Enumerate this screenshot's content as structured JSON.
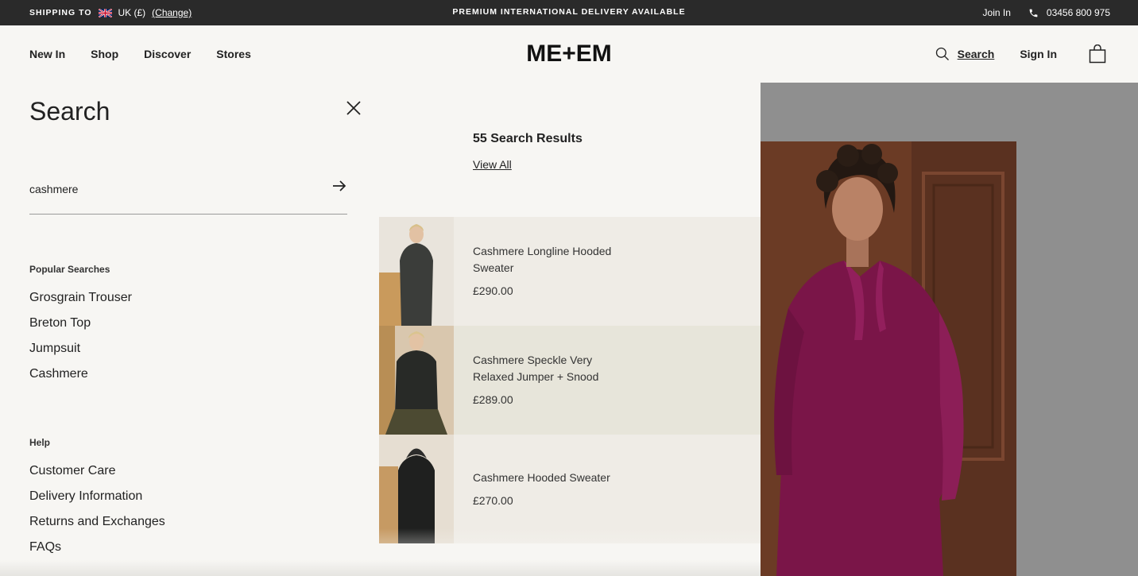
{
  "topbar": {
    "shipping_label": "SHIPPING TO",
    "region": "UK (£)",
    "change": "(Change)",
    "promo": "PREMIUM INTERNATIONAL DELIVERY AVAILABLE",
    "join": "Join In",
    "phone": "03456 800 975"
  },
  "header": {
    "nav": [
      "New In",
      "Shop",
      "Discover",
      "Stores"
    ],
    "logo": "ME+EM",
    "search": "Search",
    "signin": "Sign In",
    "icons": {
      "search": "search-icon",
      "bag": "bag-icon",
      "phone": "phone-icon",
      "flag": "uk-flag-icon"
    }
  },
  "search": {
    "title": "Search",
    "query": "cashmere",
    "popular_label": "Popular Searches",
    "popular": [
      "Grosgrain Trouser",
      "Breton Top",
      "Jumpsuit",
      "Cashmere"
    ],
    "help_label": "Help",
    "help": [
      "Customer Care",
      "Delivery Information",
      "Returns and Exchanges",
      "FAQs"
    ]
  },
  "results": {
    "count": "55 Search Results",
    "view_all": "View All",
    "items": [
      {
        "name": "Cashmere Longline Hooded Sweater",
        "price": "£290.00",
        "bg": "#efece6"
      },
      {
        "name": "Cashmere Speckle Very Relaxed Jumper + Snood",
        "price": "£289.00",
        "bg": "#e7e5da"
      },
      {
        "name": "Cashmere Hooded Sweater",
        "price": "£270.00",
        "bg": "#efece6"
      }
    ]
  },
  "colors": {
    "topbar": "#2a2a2a",
    "page_bg": "#f7f6f3",
    "hero_bg": "#8f8f8f",
    "dress": "#7a1548"
  }
}
